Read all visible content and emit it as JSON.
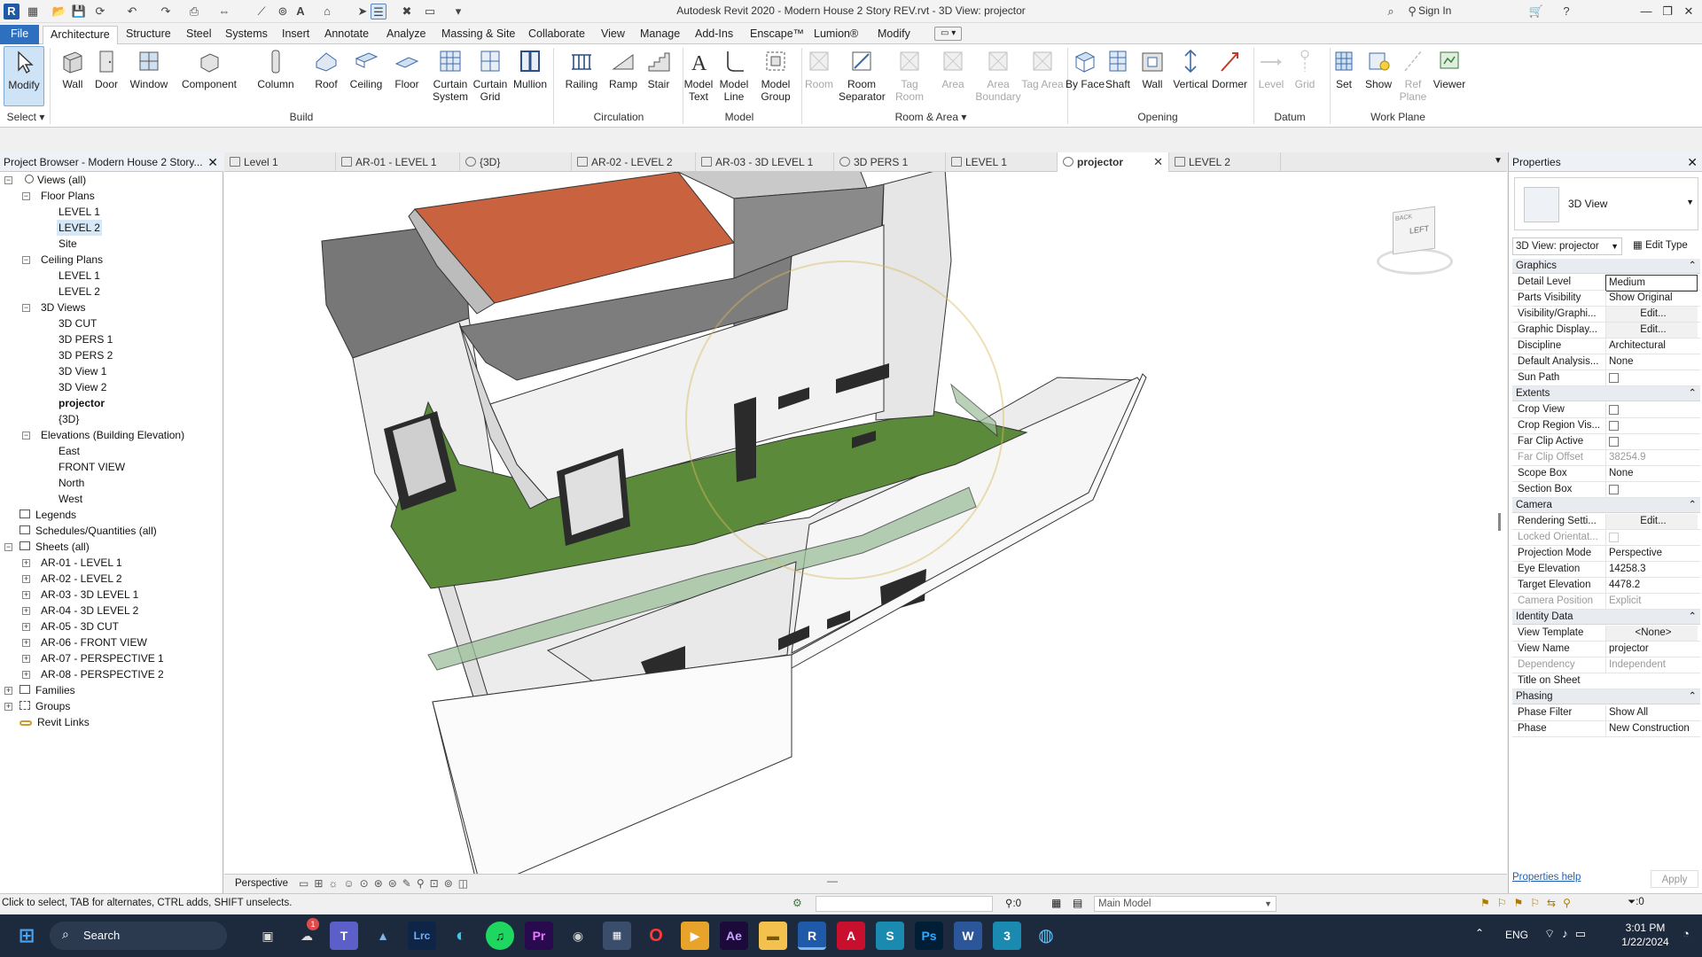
{
  "window": {
    "title": "Autodesk Revit 2020 - Modern House 2 Story REV.rvt - 3D View: projector",
    "sign_in": "Sign In"
  },
  "ribbon_tabs": [
    "File",
    "Architecture",
    "Structure",
    "Steel",
    "Systems",
    "Insert",
    "Annotate",
    "Analyze",
    "Massing & Site",
    "Collaborate",
    "View",
    "Manage",
    "Add-Ins",
    "Enscape™",
    "Lumion®",
    "Modify"
  ],
  "ribbon": {
    "select": {
      "modify": "Modify",
      "group": "Select"
    },
    "build": {
      "wall": "Wall",
      "door": "Door",
      "window": "Window",
      "component": "Component",
      "column": "Column",
      "roof": "Roof",
      "ceiling": "Ceiling",
      "floor": "Floor",
      "curtain_system": "Curtain System",
      "curtain_grid": "Curtain Grid",
      "mullion": "Mullion",
      "group": "Build"
    },
    "circulation": {
      "railing": "Railing",
      "ramp": "Ramp",
      "stair": "Stair",
      "group": "Circulation"
    },
    "model": {
      "model_text": "Model Text",
      "model_line": "Model Line",
      "model_group": "Model Group",
      "group": "Model"
    },
    "room_area": {
      "room": "Room",
      "room_separator": "Room Separator",
      "tag_room": "Tag Room",
      "area": "Area",
      "area_boundary": "Area Boundary",
      "tag_area": "Tag Area",
      "group": "Room & Area"
    },
    "opening": {
      "by_face": "By Face",
      "shaft": "Shaft",
      "wall": "Wall",
      "vertical": "Vertical",
      "dormer": "Dormer",
      "group": "Opening"
    },
    "datum": {
      "level": "Level",
      "grid": "Grid",
      "group": "Datum"
    },
    "work_plane": {
      "set": "Set",
      "show": "Show",
      "ref_plane": "Ref Plane",
      "viewer": "Viewer",
      "group": "Work Plane"
    }
  },
  "view_tabs": [
    "Level 1",
    "AR-01 - LEVEL 1",
    "{3D}",
    "AR-02 - LEVEL 2",
    "AR-03 - 3D LEVEL 1",
    "3D PERS 1",
    "LEVEL 1",
    "projector",
    "LEVEL 2"
  ],
  "browser": {
    "title": "Project Browser - Modern House 2 Story...",
    "views_all": "Views (all)",
    "floor_plans": "Floor Plans",
    "floor_items": [
      "LEVEL 1",
      "LEVEL 2",
      "Site"
    ],
    "ceiling_plans": "Ceiling Plans",
    "ceiling_items": [
      "LEVEL 1",
      "LEVEL 2"
    ],
    "views_3d": "3D Views",
    "views_3d_items": [
      "3D CUT",
      "3D PERS 1",
      "3D PERS 2",
      "3D View 1",
      "3D View 2",
      "projector",
      "{3D}"
    ],
    "elevations": "Elevations (Building Elevation)",
    "elevation_items": [
      "East",
      "FRONT VIEW",
      "North",
      "West"
    ],
    "legends": "Legends",
    "schedules": "Schedules/Quantities (all)",
    "sheets": "Sheets (all)",
    "sheet_items": [
      "AR-01 - LEVEL 1",
      "AR-02 - LEVEL 2",
      "AR-03 - 3D LEVEL 1",
      "AR-04 - 3D LEVEL 2",
      "AR-05 - 3D CUT",
      "AR-06 - FRONT VIEW",
      "AR-07 - PERSPECTIVE 1",
      "AR-08 - PERSPECTIVE 2"
    ],
    "families": "Families",
    "groups": "Groups",
    "revit_links": "Revit Links"
  },
  "viewbar": {
    "mode": "Perspective"
  },
  "viewcube": {
    "face_left": "LEFT",
    "face_back": "BACK"
  },
  "properties": {
    "title": "Properties",
    "type_name": "3D View",
    "selector": "3D View: projector",
    "edit_type": "Edit Type",
    "groups": {
      "graphics": "Graphics",
      "extents": "Extents",
      "camera": "Camera",
      "identity": "Identity Data",
      "phasing": "Phasing"
    },
    "rows": {
      "detail_level": [
        "Detail Level",
        "Medium"
      ],
      "parts_visibility": [
        "Parts Visibility",
        "Show Original"
      ],
      "visibility_graphics": [
        "Visibility/Graphi...",
        "Edit..."
      ],
      "graphic_display": [
        "Graphic Display...",
        "Edit..."
      ],
      "discipline": [
        "Discipline",
        "Architectural"
      ],
      "default_analysis": [
        "Default Analysis...",
        "None"
      ],
      "sun_path": [
        "Sun Path",
        ""
      ],
      "crop_view": [
        "Crop View",
        ""
      ],
      "crop_region": [
        "Crop Region Vis...",
        ""
      ],
      "far_clip_active": [
        "Far Clip Active",
        ""
      ],
      "far_clip_offset": [
        "Far Clip Offset",
        "38254.9"
      ],
      "scope_box": [
        "Scope Box",
        "None"
      ],
      "section_box": [
        "Section Box",
        ""
      ],
      "rendering_settings": [
        "Rendering Setti...",
        "Edit..."
      ],
      "locked_orientation": [
        "Locked Orientat...",
        ""
      ],
      "projection_mode": [
        "Projection Mode",
        "Perspective"
      ],
      "eye_elevation": [
        "Eye Elevation",
        "14258.3"
      ],
      "target_elevation": [
        "Target Elevation",
        "4478.2"
      ],
      "camera_position": [
        "Camera Position",
        "Explicit"
      ],
      "view_template": [
        "View Template",
        "<None>"
      ],
      "view_name": [
        "View Name",
        "projector"
      ],
      "dependency": [
        "Dependency",
        "Independent"
      ],
      "title_on_sheet": [
        "Title on Sheet",
        ""
      ],
      "phase_filter": [
        "Phase Filter",
        "Show All"
      ],
      "phase": [
        "Phase",
        "New Construction"
      ]
    },
    "help": "Properties help",
    "apply": "Apply"
  },
  "status": {
    "hint": "Click to select, TAB for alternates, CTRL adds, SHIFT unselects.",
    "count": ":0",
    "workset": "Main Model",
    "filter_count": ":0"
  },
  "taskbar": {
    "search": "Search",
    "lang": "ENG",
    "time": "3:01 PM",
    "date": "1/22/2024",
    "badge": "1"
  },
  "colors": {
    "file_tab": "#2f6fbf",
    "roof": "#c8623f",
    "lawn": "#5f8a3c",
    "taskbar": "#1d2a3d"
  }
}
